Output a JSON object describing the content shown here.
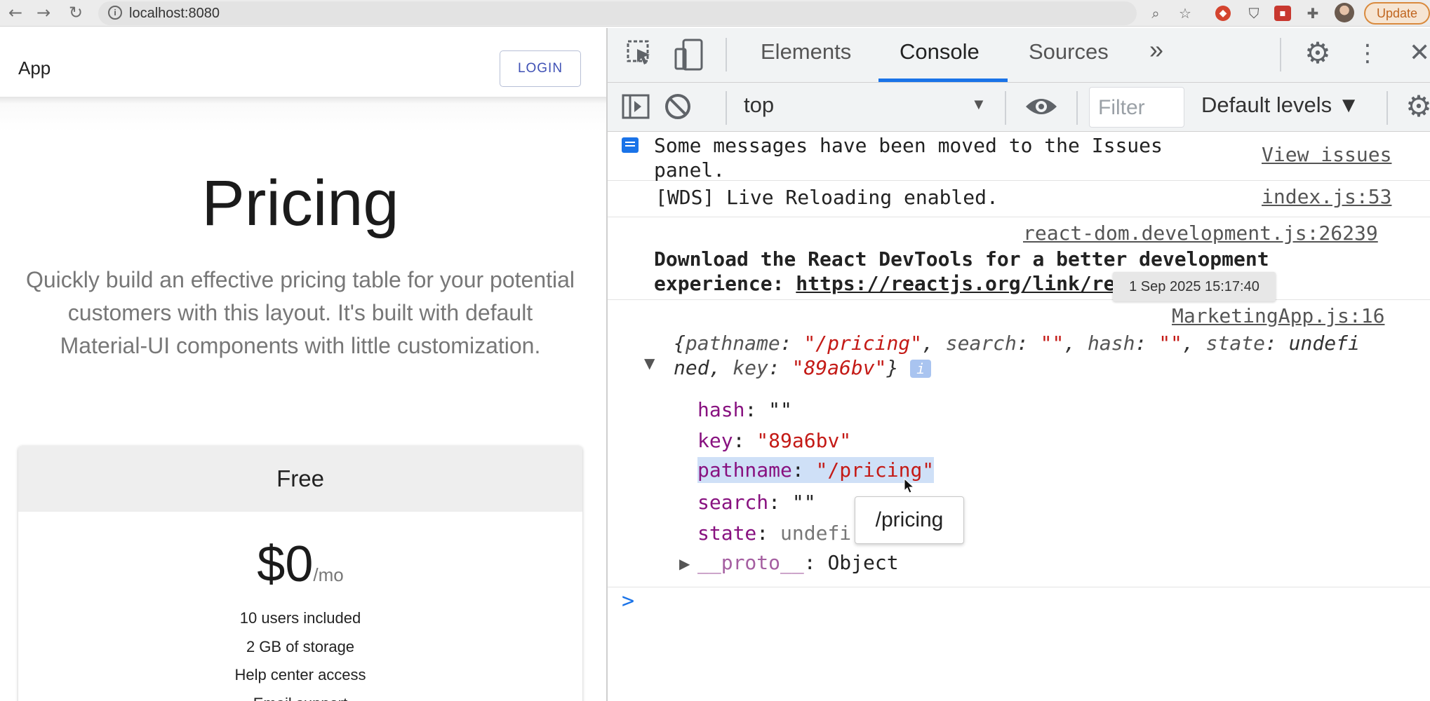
{
  "browser": {
    "url": "localhost:8080",
    "update_label": "Update"
  },
  "app": {
    "title": "App",
    "login_label": "LOGIN",
    "hero_title": "Pricing",
    "hero_subtitle": "Quickly build an effective pricing table for your potential customers with this layout. It's built with default Material-UI components with little customization.",
    "card": {
      "title": "Free",
      "price": "$0",
      "unit": "/mo",
      "features": [
        "10 users included",
        "2 GB of storage",
        "Help center access",
        "Email support"
      ]
    }
  },
  "devtools": {
    "tabs": [
      "Elements",
      "Console",
      "Sources"
    ],
    "active_tab": "Console",
    "more_label": "»",
    "context": "top",
    "filter_placeholder": "Filter",
    "levels_label": "Default levels ▼",
    "messages": [
      {
        "text_line1": "Some messages have been moved to the Issues",
        "text_line2": "panel.",
        "link": "View issues"
      },
      {
        "text": "[WDS] Live Reloading enabled.",
        "link": "index.js:53"
      },
      {
        "source": "react-dom.development.js:26239",
        "text_line1": "Download the React DevTools for a better development",
        "text_line2_prefix": "experience: ",
        "url": "https://reactjs.org/link/react-devtools"
      },
      {
        "source": "MarketingApp.js:16"
      }
    ],
    "timestamp_tooltip": "1 Sep 2025 15:17:40",
    "object": {
      "summary": {
        "k1": "pathname",
        "v1": "\"/pricing\"",
        "k2": "search",
        "v2": "\"\"",
        "k3": "hash",
        "v3": "\"\"",
        "k4": "state",
        "v4": "undefi",
        "cont": "ned",
        "k5": "key",
        "v5": "\"89a6bv\"",
        "badge": "i"
      },
      "props": [
        {
          "key": "hash",
          "value": "\"\""
        },
        {
          "key": "key",
          "value": "\"89a6bv\""
        },
        {
          "key": "pathname",
          "value": "\"/pricing\""
        },
        {
          "key": "search",
          "value": "\"\""
        },
        {
          "key": "state",
          "value": "undefi"
        },
        {
          "key": "__proto__",
          "value": "Object"
        }
      ]
    },
    "hover_tooltip": "/pricing",
    "prompt": ">"
  }
}
